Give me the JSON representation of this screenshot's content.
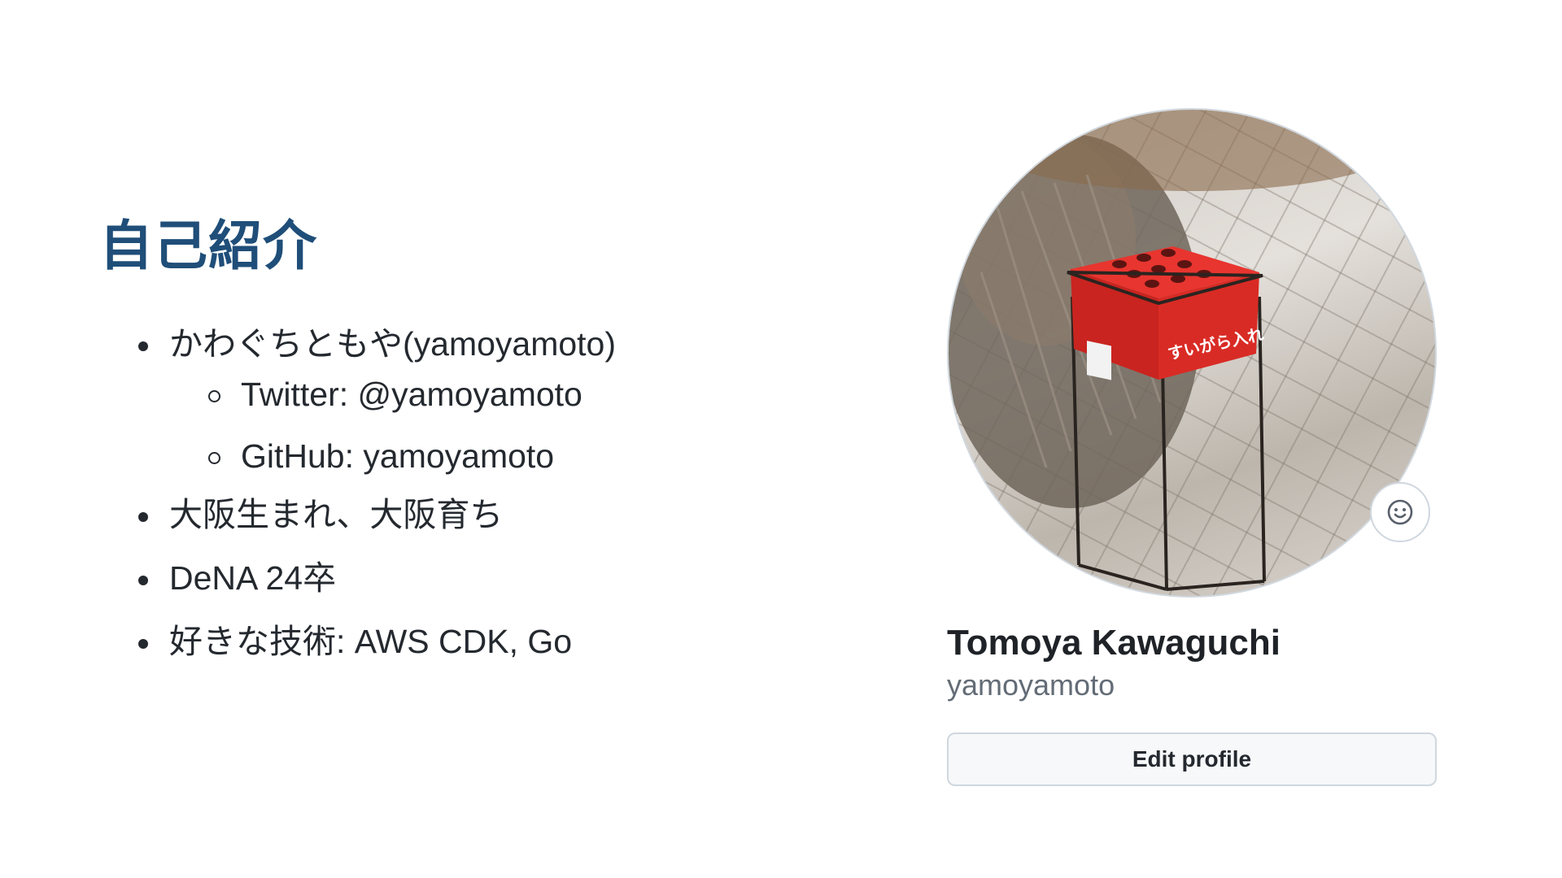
{
  "slide": {
    "title": "自己紹介",
    "title_color": "#1f4e79"
  },
  "intro": {
    "items": [
      {
        "label": "かわぐちともや(yamoyamoto)",
        "sub_items": [
          {
            "label": "Twitter: @yamoyamoto"
          },
          {
            "label": "GitHub: yamoyamoto"
          }
        ]
      },
      {
        "label": "大阪生まれ、大阪育ち"
      },
      {
        "label": "DeNA 24卒"
      },
      {
        "label": "好きな技術: AWS CDK, Go"
      }
    ]
  },
  "profile": {
    "avatar_icon": "profile-photo-red-ashtray",
    "avatar_text": "すいがら入れ",
    "status_icon": "smiley-icon",
    "name": "Tomoya Kawaguchi",
    "login": "yamoyamoto",
    "edit_button_label": "Edit profile"
  }
}
